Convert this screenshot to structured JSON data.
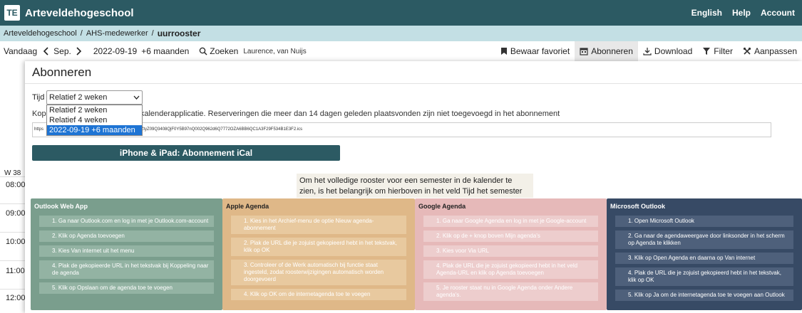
{
  "topbar": {
    "logo": "TE",
    "brand": "Arteveldehogeschool",
    "links": [
      "English",
      "Help",
      "Account"
    ]
  },
  "breadcrumb": {
    "items": [
      "Arteveldehogeschool",
      "AHS-medewerker"
    ],
    "separator": "/",
    "current": "uurrooster"
  },
  "toolbar": {
    "today": "Vandaag",
    "month": "Sep.",
    "date": "2022-09-19",
    "range": "+6 maanden",
    "search_label": "Zoeken",
    "search_sub": "Laurence, van Nuijs",
    "actions": {
      "favorite": "Bewaar favoriet",
      "subscribe": "Abonneren",
      "download": "Download",
      "filter": "Filter",
      "customize": "Aanpassen"
    }
  },
  "calendar": {
    "week": "W 38",
    "times": [
      "08:00",
      "09:00",
      "10:00",
      "11:00",
      "12:00"
    ]
  },
  "modal": {
    "title": "Abonneren",
    "time_label": "Tijd",
    "select_value": "Relatief 2 weken",
    "options": [
      "Relatief 2 weken",
      "Relatief 4 weken",
      "2022-09-19 +6 maanden"
    ],
    "selected_option_index": 2,
    "description_start": "Kop",
    "description_end": "n de kalenderapplicatie. Reserveringen die meer dan 14 dagen geleden plaatsvonden zijn niet toegevoegd in het abonnement",
    "url_start": "https",
    "url_end": "r6Z122OZtyZ09Q3408QjF0Y5B97nQ002Q962d6Q7772OZA6BB6QC1A3F29F534B1E3F2.ics",
    "ical_button": "iPhone & iPad: Abonnement iCal",
    "note": "Om het volledige rooster voor een semester in de kalender te zien, is het belangrijk om hierboven in het veld Tijd het semester te selecteren.."
  },
  "cards": {
    "outlookweb": {
      "title": "Outlook Web App",
      "steps": [
        "1. Ga naar Outlook.com en log in met je Outlook.com-account",
        "2. Klik op Agenda toevoegen",
        "3. Kies Van internet uit het menu",
        "4. Plak de gekopieerde URL in het tekstvak bij Koppeling naar de agenda",
        "5. Klik op Opslaan om de agenda toe te voegen"
      ]
    },
    "apple": {
      "title": "Apple Agenda",
      "steps": [
        "1. Kies in het Archief-menu de optie Nieuw agenda-abonnement",
        "2. Plak de URL die je zojuist gekopieerd hebt in het tekstvak, klik op OK",
        "3. Controleer of de Werk automatisch bij functie staat ingesteld, zodat roosterwijzigingen automatisch worden doorgevoerd",
        "4. Klik op OK om de internetagenda toe te voegen"
      ]
    },
    "google": {
      "title": "Google Agenda",
      "steps": [
        "1. Ga naar Google Agenda en log in met je Google-account",
        "2. Klik op de + knop boven Mijn agenda's",
        "3. Kies voor Via URL",
        "4. Plak de URL die je zojuist gekopieerd hebt in het veld Agenda-URL en klik op Agenda toevoegen",
        "5. Je rooster staat nu in Google Agenda onder Andere agenda's."
      ]
    },
    "microsoft": {
      "title": "Microsoft Outlook",
      "steps": [
        "1. Open Microsoft Outlook",
        "2. Ga naar de agendaweergave door linksonder in het scherm op Agenda te klikken",
        "3. Klik op Open Agenda en daarna op Van internet",
        "4. Plak de URL die je zojuist gekopieerd hebt in het tekstvak, klik op OK",
        "5. Klik op Ja om de internetagenda toe te voegen aan Outlook"
      ]
    }
  }
}
